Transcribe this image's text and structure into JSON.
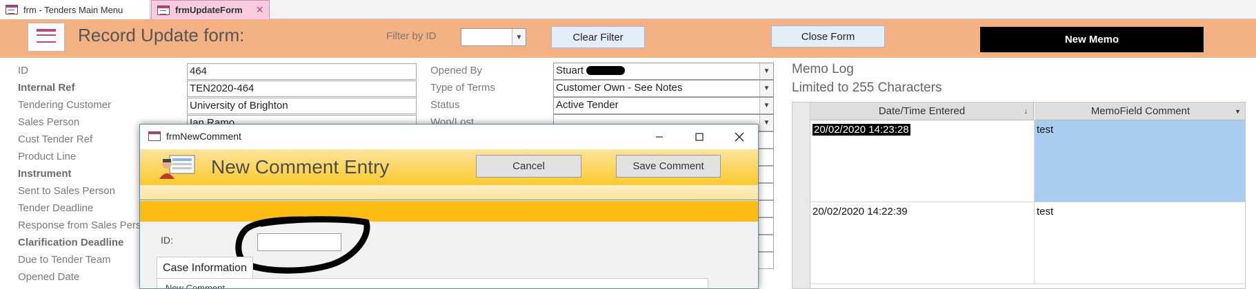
{
  "tabs": [
    {
      "label": "frm - Tenders Main Menu"
    },
    {
      "label": "frmUpdateForm",
      "close": "×"
    }
  ],
  "header": {
    "title": "Record Update form:",
    "filter_label": "Filter by ID",
    "filter_value": "",
    "clear_filter": "Clear Filter",
    "close_form": "Close Form",
    "new_memo": "New Memo"
  },
  "fields_left": [
    {
      "label": "ID",
      "value": "464",
      "bold": false
    },
    {
      "label": "Internal Ref",
      "value": "TEN2020-464",
      "bold": true
    },
    {
      "label": "Tendering Customer",
      "value": "University of Brighton",
      "bold": false
    },
    {
      "label": "Sales Person",
      "value": "Ian Ramo",
      "bold": false
    },
    {
      "label": "Cust Tender Ref",
      "value": "",
      "bold": false
    },
    {
      "label": "Product Line",
      "value": "",
      "bold": false
    },
    {
      "label": "Instrument",
      "value": "",
      "bold": true
    },
    {
      "label": "Sent to Sales Person",
      "value": "",
      "bold": false
    },
    {
      "label": "Tender Deadline",
      "value": "",
      "bold": false
    },
    {
      "label": "Response from Sales Person",
      "value": "",
      "bold": false
    },
    {
      "label": "Clarification Deadline",
      "value": "",
      "bold": true
    },
    {
      "label": "Due to Tender Team",
      "value": "",
      "bold": false
    },
    {
      "label": "Opened Date",
      "value": "",
      "bold": false
    }
  ],
  "fields_middle": [
    {
      "label": "Opened By",
      "value": "Stuart"
    },
    {
      "label": "Type of Terms",
      "value": "Customer Own - See Notes"
    },
    {
      "label": "Status",
      "value": "Active Tender"
    },
    {
      "label": "Won/Lost",
      "value": ""
    }
  ],
  "memo": {
    "title": "Memo Log",
    "subtitle": "Limited to 255 Characters",
    "col_date": "Date/Time Entered",
    "col_comment": "MemoField Comment",
    "rows": [
      {
        "date": "20/02/2020 14:23:28",
        "comment": "test"
      },
      {
        "date": "20/02/2020 14:22:39",
        "comment": "test"
      }
    ]
  },
  "dialog": {
    "window_title": "frmNewComment",
    "heading": "New Comment Entry",
    "cancel": "Cancel",
    "save": "Save Comment",
    "id_label": "ID:",
    "id_value": "",
    "tab": "Case Information",
    "panel_text": "New Comment"
  },
  "colors": {
    "header_band": "#f4b183",
    "dialog_gold": "#fcbc12",
    "selected_row": "#a9cdf0"
  }
}
